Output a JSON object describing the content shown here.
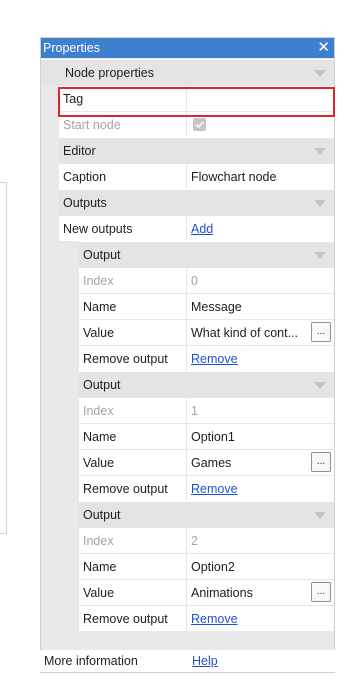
{
  "panel": {
    "title": "Properties",
    "close_glyph": "✕",
    "close_icon": "close-icon",
    "header_color": "#3f7fd0"
  },
  "node_properties": {
    "label": "Node properties",
    "tag_label": "Tag",
    "tag_value": "",
    "start_node_label": "Start node",
    "start_node_checked": true
  },
  "editor": {
    "label": "Editor",
    "caption_label": "Caption",
    "caption_value": "Flowchart node"
  },
  "outputs": {
    "label": "Outputs",
    "new_outputs_label": "New outputs",
    "add_link": "Add",
    "items": [
      {
        "header": "Output",
        "index_label": "Index",
        "index_value": "0",
        "name_label": "Name",
        "name_value": "Message",
        "value_label": "Value",
        "value_value": "What kind of cont...",
        "remove_label": "Remove output",
        "remove_link": "Remove",
        "ellipsis": "..."
      },
      {
        "header": "Output",
        "index_label": "Index",
        "index_value": "1",
        "name_label": "Name",
        "name_value": "Option1",
        "value_label": "Value",
        "value_value": "Games",
        "remove_label": "Remove output",
        "remove_link": "Remove",
        "ellipsis": "..."
      },
      {
        "header": "Output",
        "index_label": "Index",
        "index_value": "2",
        "name_label": "Name",
        "name_value": "Option2",
        "value_label": "Value",
        "value_value": "Animations",
        "remove_label": "Remove output",
        "remove_link": "Remove",
        "ellipsis": "..."
      }
    ]
  },
  "footer": {
    "more_info_label": "More information",
    "help_link": "Help"
  },
  "colors": {
    "highlight": "#e0242b",
    "link": "#1f4fd6"
  }
}
